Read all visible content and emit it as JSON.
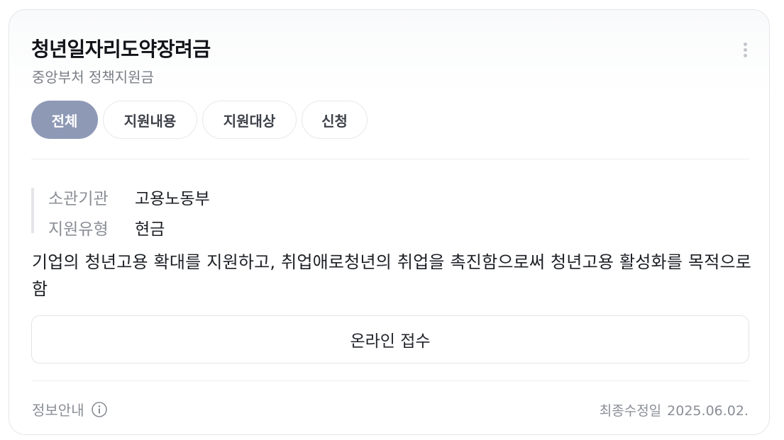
{
  "header": {
    "title": "청년일자리도약장려금",
    "subtitle": "중앙부처 정책지원금"
  },
  "tabs": [
    {
      "label": "전체",
      "active": true
    },
    {
      "label": "지원내용",
      "active": false
    },
    {
      "label": "지원대상",
      "active": false
    },
    {
      "label": "신청",
      "active": false
    }
  ],
  "info": {
    "agency": {
      "key": "소관기관",
      "value": "고용노동부"
    },
    "type": {
      "key": "지원유형",
      "value": "현금"
    }
  },
  "description": "기업의 청년고용 확대를 지원하고, 취업애로청년의 취업을 촉진함으로써 청년고용 활성화를 목적으로 함",
  "apply_button": "온라인 접수",
  "footer": {
    "info_label": "정보안내",
    "info_icon": "info-circle-icon",
    "updated_label": "최종수정일",
    "updated_date": "2025.06.02."
  },
  "colors": {
    "active_tab": "#8e99b6",
    "text": "#1c1f24",
    "muted": "#8a8e95"
  }
}
